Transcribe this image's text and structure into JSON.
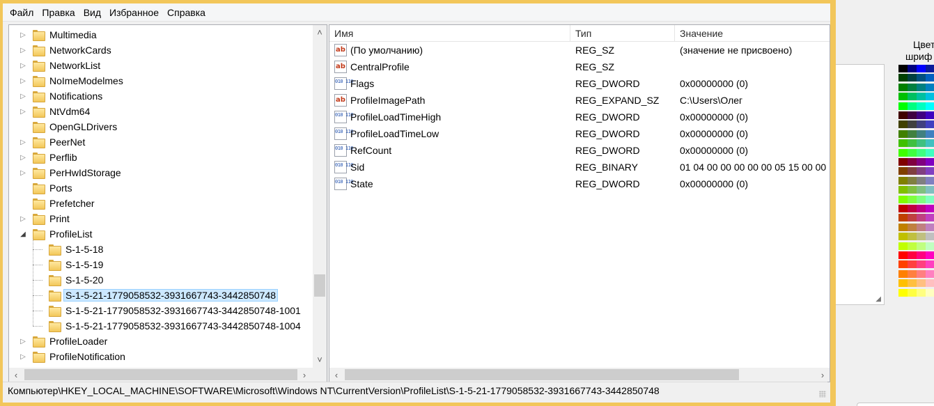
{
  "menu": [
    "Файл",
    "Правка",
    "Вид",
    "Избранное",
    "Справка"
  ],
  "tree": {
    "items": [
      {
        "label": "Multimedia",
        "level": 0,
        "expander": "collapsed"
      },
      {
        "label": "NetworkCards",
        "level": 0,
        "expander": "collapsed"
      },
      {
        "label": "NetworkList",
        "level": 0,
        "expander": "collapsed"
      },
      {
        "label": "NoImeModelmes",
        "level": 0,
        "expander": "collapsed"
      },
      {
        "label": "Notifications",
        "level": 0,
        "expander": "collapsed"
      },
      {
        "label": "NtVdm64",
        "level": 0,
        "expander": "collapsed"
      },
      {
        "label": "OpenGLDrivers",
        "level": 0,
        "expander": "none"
      },
      {
        "label": "PeerNet",
        "level": 0,
        "expander": "collapsed"
      },
      {
        "label": "Perflib",
        "level": 0,
        "expander": "collapsed"
      },
      {
        "label": "PerHwIdStorage",
        "level": 0,
        "expander": "collapsed"
      },
      {
        "label": "Ports",
        "level": 0,
        "expander": "none"
      },
      {
        "label": "Prefetcher",
        "level": 0,
        "expander": "none"
      },
      {
        "label": "Print",
        "level": 0,
        "expander": "collapsed"
      },
      {
        "label": "ProfileList",
        "level": 0,
        "expander": "expanded"
      },
      {
        "label": "S-1-5-18",
        "level": 1,
        "expander": "none"
      },
      {
        "label": "S-1-5-19",
        "level": 1,
        "expander": "none"
      },
      {
        "label": "S-1-5-20",
        "level": 1,
        "expander": "none"
      },
      {
        "label": "S-1-5-21-1779058532-3931667743-3442850748",
        "level": 1,
        "expander": "none",
        "selected": true
      },
      {
        "label": "S-1-5-21-1779058532-3931667743-3442850748-1001",
        "level": 1,
        "expander": "none"
      },
      {
        "label": "S-1-5-21-1779058532-3931667743-3442850748-1004",
        "level": 1,
        "expander": "none"
      },
      {
        "label": "ProfileLoader",
        "level": 0,
        "expander": "collapsed"
      },
      {
        "label": "ProfileNotification",
        "level": 0,
        "expander": "collapsed"
      }
    ]
  },
  "values": {
    "columns": [
      "Имя",
      "Тип",
      "Значение"
    ],
    "rows": [
      {
        "icon": "string-value-icon",
        "name": "(По умолчанию)",
        "type": "REG_SZ",
        "data": "(значение не присвоено)"
      },
      {
        "icon": "string-value-icon",
        "name": "CentralProfile",
        "type": "REG_SZ",
        "data": ""
      },
      {
        "icon": "binary-value-icon",
        "name": "Flags",
        "type": "REG_DWORD",
        "data": "0x00000000 (0)"
      },
      {
        "icon": "string-value-icon",
        "name": "ProfileImagePath",
        "type": "REG_EXPAND_SZ",
        "data": "C:\\Users\\Олег"
      },
      {
        "icon": "binary-value-icon",
        "name": "ProfileLoadTimeHigh",
        "type": "REG_DWORD",
        "data": "0x00000000 (0)"
      },
      {
        "icon": "binary-value-icon",
        "name": "ProfileLoadTimeLow",
        "type": "REG_DWORD",
        "data": "0x00000000 (0)"
      },
      {
        "icon": "binary-value-icon",
        "name": "RefCount",
        "type": "REG_DWORD",
        "data": "0x00000000 (0)"
      },
      {
        "icon": "binary-value-icon",
        "name": "Sid",
        "type": "REG_BINARY",
        "data": "01 04 00 00 00 00 00 05 15 00 00"
      },
      {
        "icon": "binary-value-icon",
        "name": "State",
        "type": "REG_DWORD",
        "data": "0x00000000 (0)"
      }
    ]
  },
  "status": {
    "path": "Компьютер\\HKEY_LOCAL_MACHINE\\SOFTWARE\\Microsoft\\Windows NT\\CurrentVersion\\ProfileList\\S-1-5-21-1779058532-3931667743-3442850748"
  },
  "background_app": {
    "label_line1": "Цвет",
    "label_line2": "шриф"
  },
  "colors": {
    "window_frame": "#f2c65a",
    "selection": "#cce8ff",
    "folder": "#f3c759"
  },
  "palette_colors": [
    "#000000",
    "#000080",
    "#0000ff",
    "#0a1a9a",
    "#004000",
    "#004040",
    "#005080",
    "#0060c0",
    "#008000",
    "#008040",
    "#008080",
    "#0080c0",
    "#00c000",
    "#00c060",
    "#00c0a0",
    "#00c0e0",
    "#00ff00",
    "#00ff80",
    "#00ffc0",
    "#00ffff",
    "#400000",
    "#400040",
    "#400080",
    "#4000c0",
    "#404000",
    "#404040",
    "#404080",
    "#4040c0",
    "#408000",
    "#408040",
    "#408080",
    "#4080c0",
    "#40c000",
    "#40c040",
    "#40c080",
    "#40c0c0",
    "#40ff00",
    "#40ff40",
    "#40ff80",
    "#40ffc0",
    "#800000",
    "#800040",
    "#800080",
    "#8000c0",
    "#804000",
    "#804040",
    "#804080",
    "#8040c0",
    "#808000",
    "#808040",
    "#808080",
    "#8080c0",
    "#80c000",
    "#80c040",
    "#80c080",
    "#80c0c0",
    "#80ff00",
    "#80ff40",
    "#80ff80",
    "#80ffc0",
    "#c00000",
    "#c00040",
    "#c00080",
    "#c000c0",
    "#c04000",
    "#c04040",
    "#c04080",
    "#c040c0",
    "#c08000",
    "#c08040",
    "#c08080",
    "#c080c0",
    "#c0c000",
    "#c0c040",
    "#c0c080",
    "#c0c0c0",
    "#c0ff00",
    "#c0ff40",
    "#c0ff80",
    "#c0ffc0",
    "#ff0000",
    "#ff0040",
    "#ff0080",
    "#ff00c0",
    "#ff4000",
    "#ff4040",
    "#ff4080",
    "#ff40c0",
    "#ff8000",
    "#ff8040",
    "#ff8080",
    "#ff80c0",
    "#ffc000",
    "#ffc040",
    "#ffc080",
    "#ffc0c0",
    "#ffff00",
    "#ffff40",
    "#ffff80",
    "#ffffc0"
  ]
}
